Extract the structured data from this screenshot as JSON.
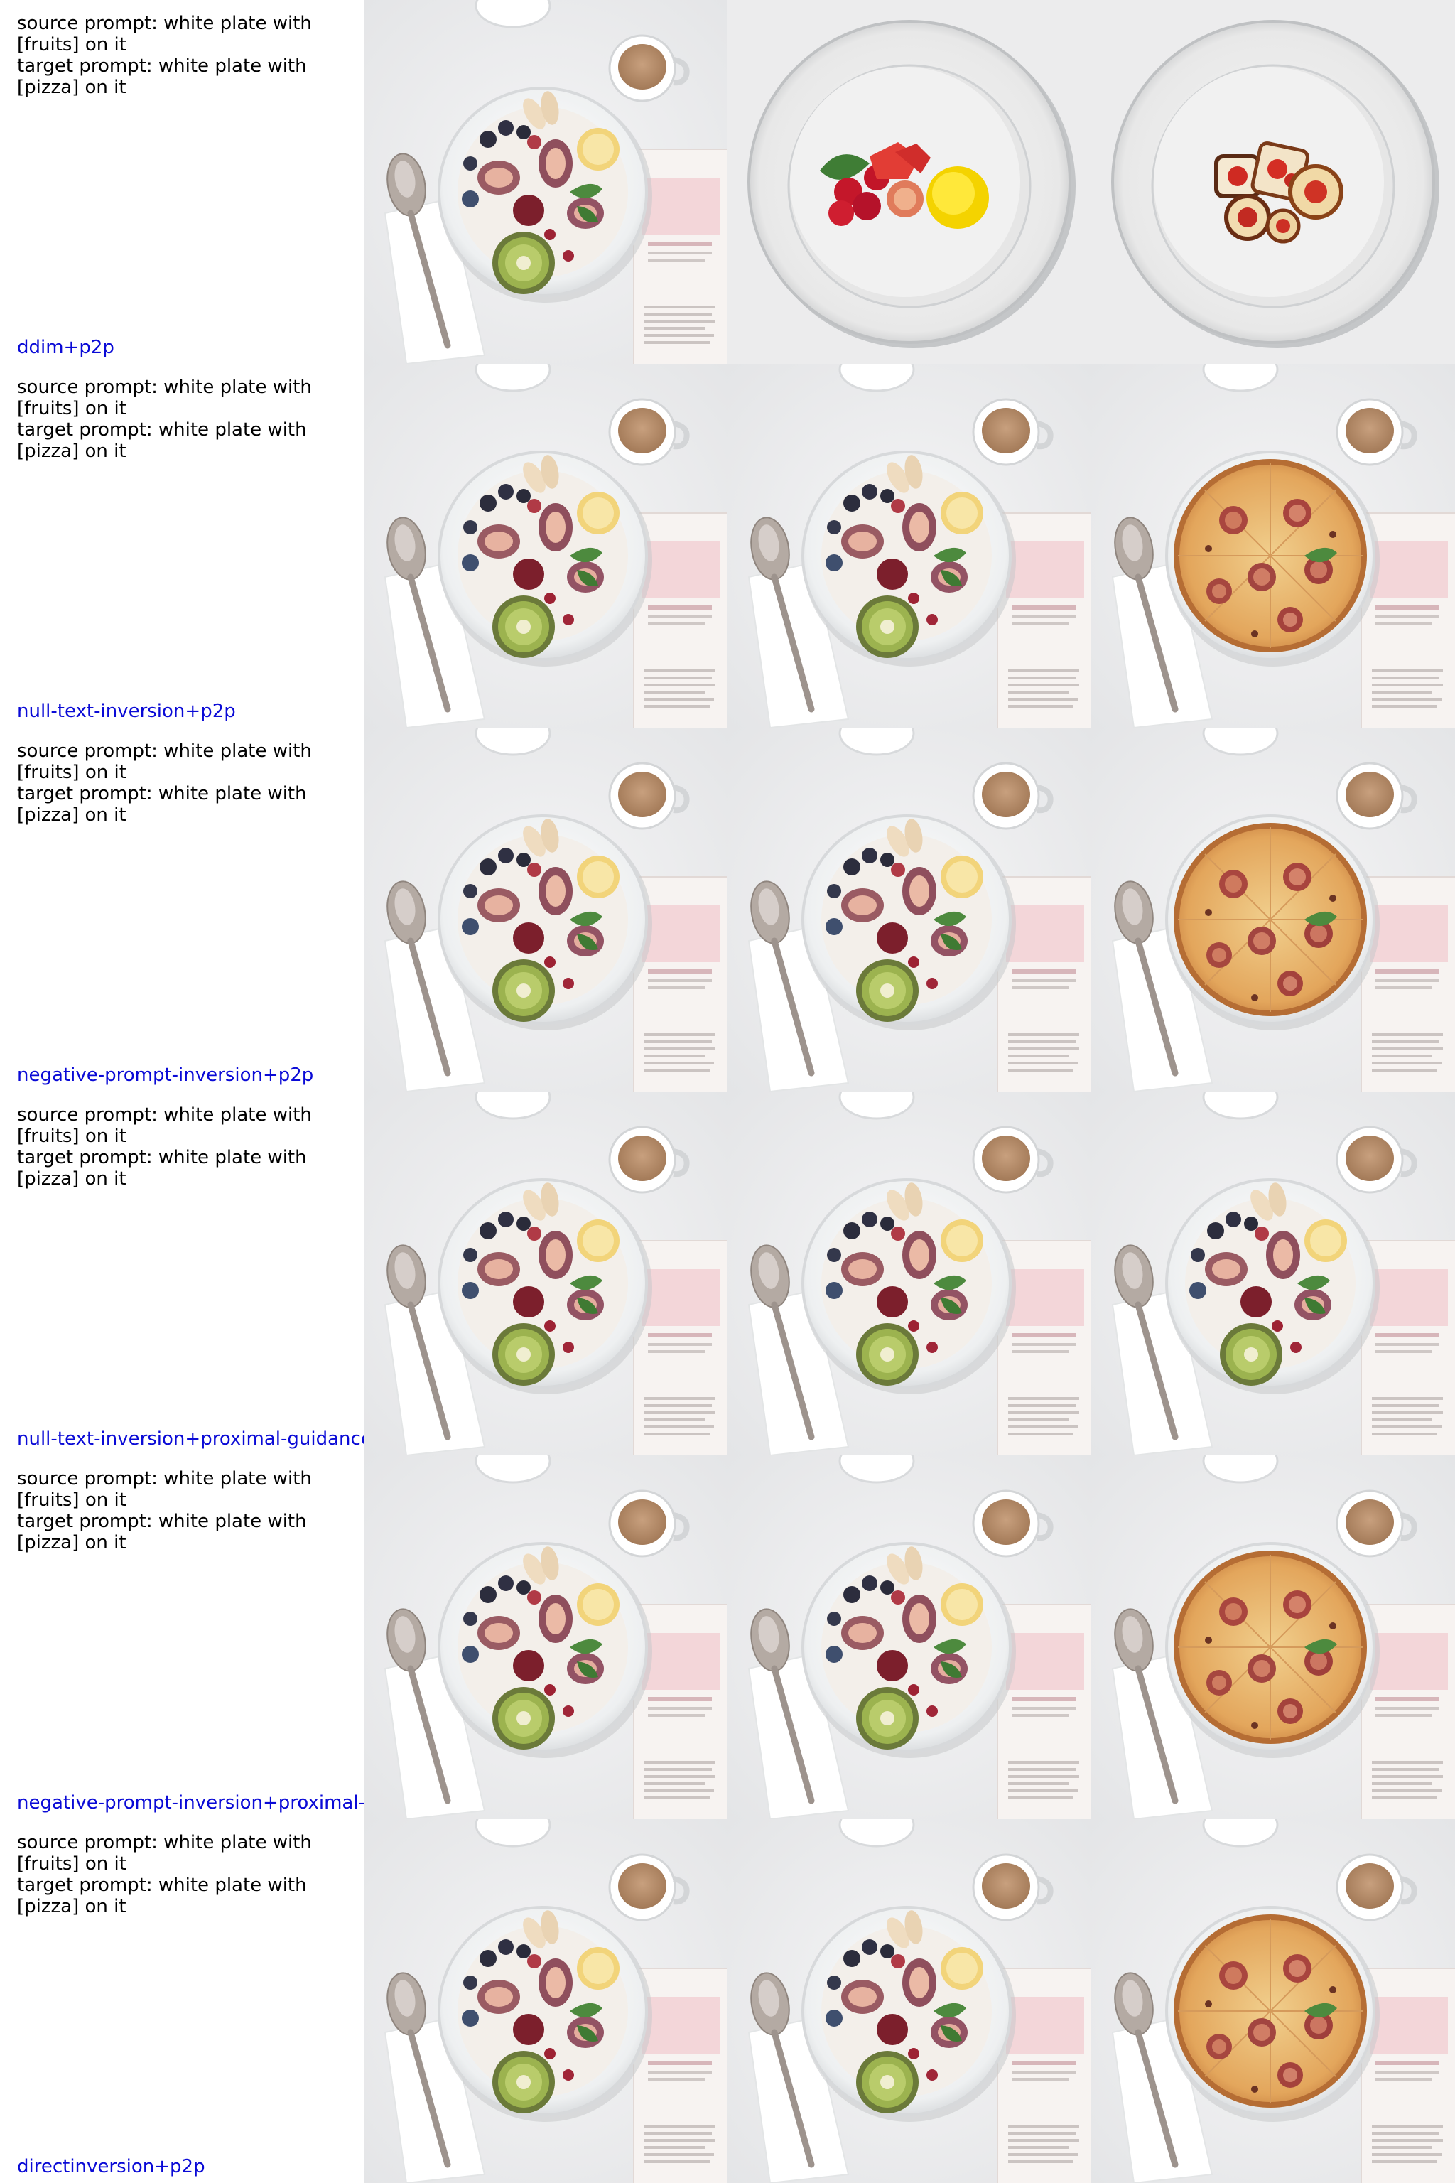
{
  "prompt": {
    "source_line": "source prompt: white plate with [fruits] on it",
    "target_line": "target prompt: white plate with [pizza] on it"
  },
  "rows": [
    {
      "method": "ddim+p2p",
      "cells": [
        "fruit-bowl-scene",
        "fruits-on-empty-plate",
        "pizza-bites-on-plate"
      ]
    },
    {
      "method": "null-text-inversion+p2p",
      "cells": [
        "fruit-bowl-scene",
        "fruit-bowl-scene",
        "pizza-in-bowl-scene"
      ]
    },
    {
      "method": "negative-prompt-inversion+p2p",
      "cells": [
        "fruit-bowl-scene",
        "fruit-bowl-scene",
        "pizza-in-bowl-scene"
      ]
    },
    {
      "method": "null-text-inversion+proximal-guidance",
      "cells": [
        "fruit-bowl-scene",
        "fruit-bowl-scene",
        "fruit-bowl-scene"
      ]
    },
    {
      "method": "negative-prompt-inversion+proximal-g",
      "cells": [
        "fruit-bowl-scene",
        "fruit-bowl-scene",
        "pizza-in-bowl-scene"
      ]
    },
    {
      "method": "directinversion+p2p",
      "cells": [
        "fruit-bowl-scene",
        "fruit-bowl-scene",
        "pizza-in-bowl-scene"
      ]
    }
  ],
  "colors": {
    "method_label": "#0a0ad6",
    "prompt_text": "#000000",
    "background": "#ffffff"
  }
}
